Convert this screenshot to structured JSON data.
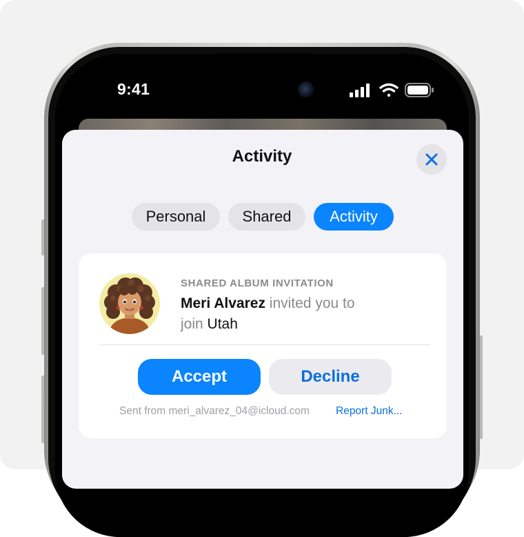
{
  "status_bar": {
    "time": "9:41",
    "icons": [
      "cellular-signal-icon",
      "wifi-icon",
      "battery-icon"
    ]
  },
  "sheet": {
    "title": "Activity",
    "close_icon": "close-icon"
  },
  "segments": [
    {
      "label": "Personal",
      "selected": false
    },
    {
      "label": "Shared",
      "selected": false
    },
    {
      "label": "Activity",
      "selected": true
    }
  ],
  "invitation": {
    "label": "SHARED ALBUM INVITATION",
    "sender_name": "Meri Alvarez",
    "text_mid": " invited you to",
    "text_join": "join ",
    "album_name": "Utah",
    "accept_label": "Accept",
    "decline_label": "Decline",
    "sent_from": "Sent from meri_alvarez_04@icloud.com",
    "report_label": "Report Junk..."
  },
  "colors": {
    "accent": "#0a84ff",
    "sheet_bg": "#f2f2f7",
    "card_bg": "#ffffff",
    "secondary_text": "#8a8a8e"
  }
}
